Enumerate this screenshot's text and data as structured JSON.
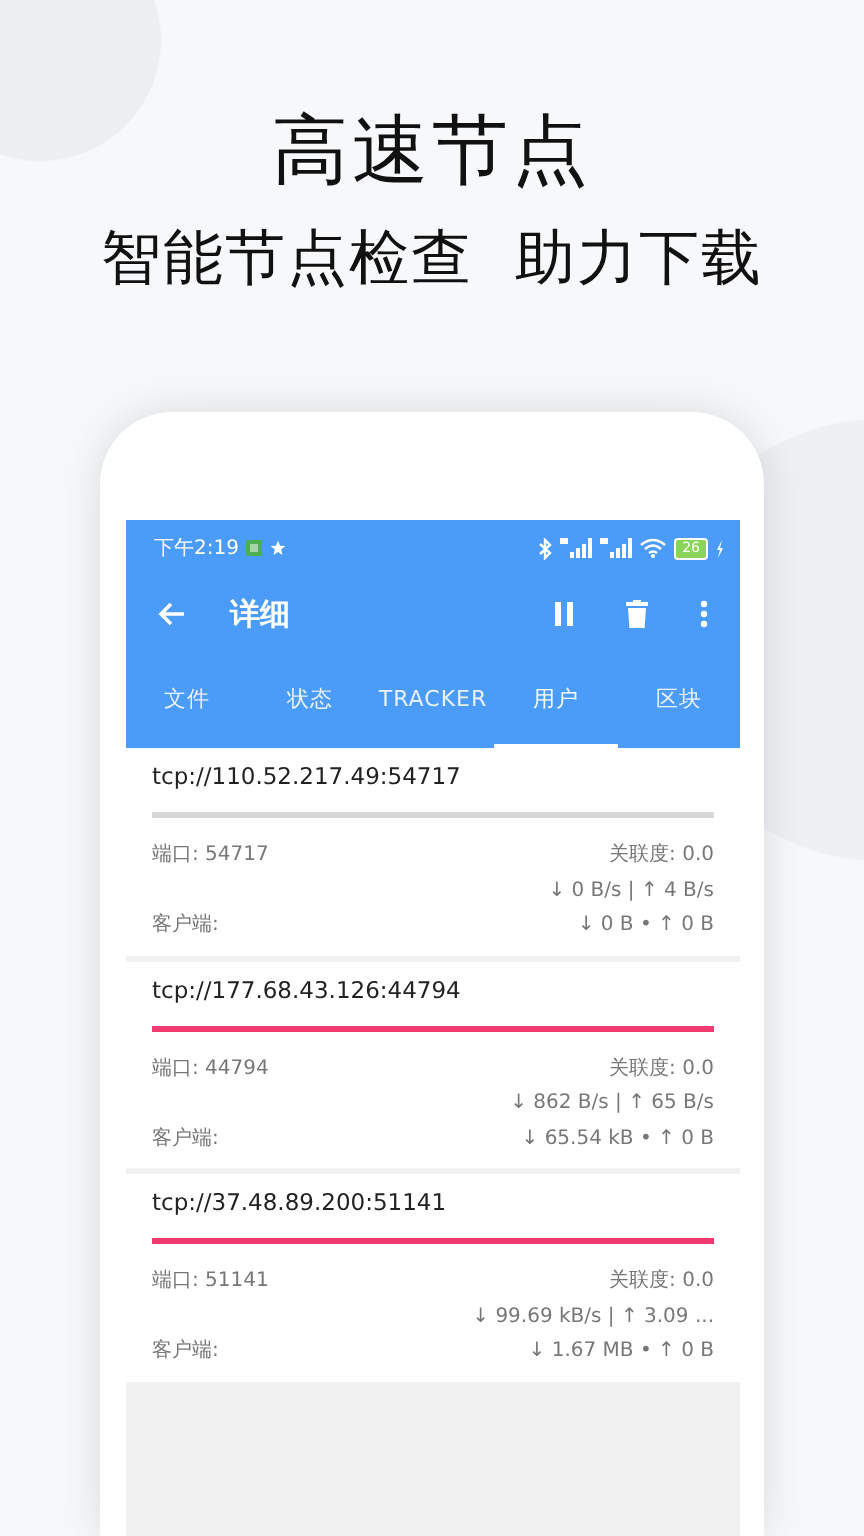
{
  "headline": "高速节点",
  "subtitle": "智能节点检查  助力下载",
  "status_bar": {
    "time": "下午2:19",
    "battery": "26"
  },
  "toolbar": {
    "title": "详细"
  },
  "tabs": [
    {
      "label": "文件",
      "selected": false
    },
    {
      "label": "状态",
      "selected": false
    },
    {
      "label": "TRACKER",
      "selected": false
    },
    {
      "label": "用户",
      "selected": true
    },
    {
      "label": "区块",
      "selected": false
    }
  ],
  "peers": [
    {
      "address": "tcp://110.52.217.49:54717",
      "level": 0,
      "port": "端口: 54717",
      "relevance": "关联度: 0.0",
      "speed": "↓ 0 B/s | ↑ 4 B/s",
      "client": "客户端:",
      "total": "↓ 0 B • ↑ 0 B"
    },
    {
      "address": "tcp://177.68.43.126:44794",
      "level": 1,
      "port": "端口: 44794",
      "relevance": "关联度: 0.0",
      "speed": "↓ 862 B/s | ↑ 65 B/s",
      "client": "客户端:",
      "total": "↓ 65.54 kB • ↑ 0 B"
    },
    {
      "address": "tcp://37.48.89.200:51141",
      "level": 1,
      "port": "端口: 51141",
      "relevance": "关联度: 0.0",
      "speed": "↓ 99.69 kB/s | ↑ 3.09 ...",
      "client": "客户端:",
      "total": "↓ 1.67 MB • ↑ 0 B"
    }
  ]
}
